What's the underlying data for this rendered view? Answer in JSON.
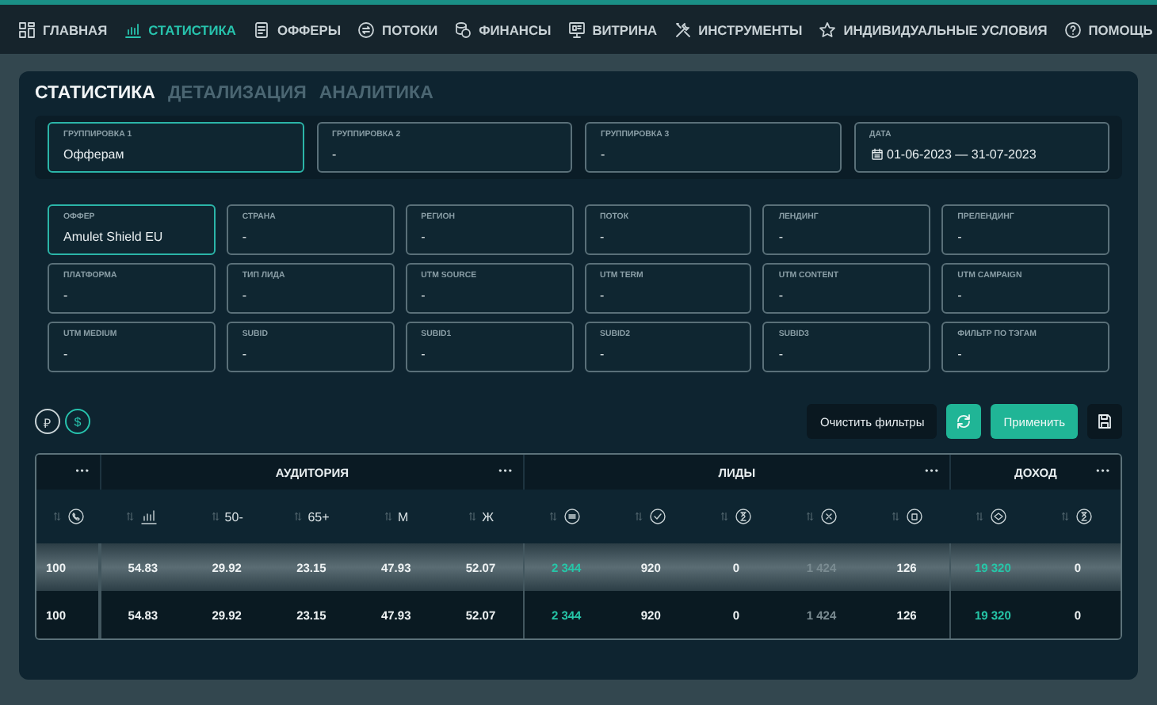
{
  "nav": [
    {
      "label": "ГЛАВНАЯ",
      "selected": false
    },
    {
      "label": "СТАТИСТИКА",
      "selected": true
    },
    {
      "label": "ОФФЕРЫ",
      "selected": false
    },
    {
      "label": "ПОТОКИ",
      "selected": false
    },
    {
      "label": "ФИНАНСЫ",
      "selected": false
    },
    {
      "label": "ВИТРИНА",
      "selected": false
    },
    {
      "label": "ИНСТРУМЕНТЫ",
      "selected": false
    },
    {
      "label": "ИНДИВИДУАЛЬНЫЕ УСЛОВИЯ",
      "selected": false
    },
    {
      "label": "ПОМОЩЬ",
      "selected": false
    }
  ],
  "tabs": [
    {
      "label": "СТАТИСТИКА",
      "selected": true
    },
    {
      "label": "ДЕТАЛИЗАЦИЯ",
      "selected": false
    },
    {
      "label": "АНАЛИТИКА",
      "selected": false
    }
  ],
  "grouping": [
    {
      "kind": "select",
      "label": "ГРУППИРОВКА 1",
      "value": "Офферам",
      "focused": true
    },
    {
      "kind": "select",
      "label": "ГРУППИРОВКА 2",
      "value": "-",
      "focused": false
    },
    {
      "kind": "select",
      "label": "ГРУППИРОВКА 3",
      "value": "-",
      "focused": false
    },
    {
      "kind": "date",
      "label": "ДАТА",
      "value": "01-06-2023 — 31-07-2023",
      "focused": false
    }
  ],
  "filters": [
    {
      "label": "ОФФЕР",
      "value": "Amulet Shield EU",
      "focused": true
    },
    {
      "label": "СТРАНА",
      "value": "-",
      "focused": false
    },
    {
      "label": "РЕГИОН",
      "value": "-",
      "focused": false
    },
    {
      "label": "ПОТОК",
      "value": "-",
      "focused": false
    },
    {
      "label": "ЛЕНДИНГ",
      "value": "-",
      "focused": false
    },
    {
      "label": "ПРЕЛЕНДИНГ",
      "value": "-",
      "focused": false
    },
    {
      "label": "ПЛАТФОРМА",
      "value": "-",
      "focused": false
    },
    {
      "label": "ТИП ЛИДА",
      "value": "-",
      "focused": false
    },
    {
      "label": "UTM SOURCE",
      "value": "-",
      "focused": false
    },
    {
      "label": "UTM TERM",
      "value": "-",
      "focused": false
    },
    {
      "label": "UTM CONTENT",
      "value": "-",
      "focused": false
    },
    {
      "label": "UTM CAMPAIGN",
      "value": "-",
      "focused": false
    },
    {
      "label": "UTM MEDIUM",
      "value": "-",
      "focused": false
    },
    {
      "label": "SUBID",
      "value": "-",
      "focused": false
    },
    {
      "label": "SUBID1",
      "value": "-",
      "focused": false
    },
    {
      "label": "SUBID2",
      "value": "-",
      "focused": false
    },
    {
      "label": "SUBID3",
      "value": "-",
      "focused": false
    },
    {
      "label": "ФИЛЬТР ПО ТЭГАМ",
      "value": "-",
      "focused": false
    }
  ],
  "currencies": [
    {
      "symbol": "₽",
      "selected": false
    },
    {
      "symbol": "$",
      "selected": true
    }
  ],
  "actions": {
    "clear": "Очистить фильтры",
    "apply": "Применить"
  },
  "table": {
    "groups": [
      {
        "menu": "•••"
      },
      {
        "label": "АУДИТОРИЯ",
        "menu": "•••"
      },
      {
        "label": "ЛИДЫ",
        "menu": "•••"
      },
      {
        "label": "ДОХОД",
        "menu": "•••"
      }
    ],
    "columns": [
      {
        "kind": "icon",
        "accent": false,
        "dimmed": false
      },
      {
        "kind": "icon",
        "accent": false,
        "dimmed": false
      },
      {
        "kind": "text",
        "label": "50-",
        "accent": false,
        "dimmed": false
      },
      {
        "kind": "text",
        "label": "65+",
        "accent": false,
        "dimmed": false
      },
      {
        "kind": "text",
        "label": "М",
        "accent": false,
        "dimmed": false
      },
      {
        "kind": "text",
        "label": "Ж",
        "accent": false,
        "dimmed": false
      },
      {
        "kind": "icon",
        "accent": true,
        "dimmed": false
      },
      {
        "kind": "icon",
        "accent": false,
        "dimmed": false
      },
      {
        "kind": "icon",
        "accent": false,
        "dimmed": false
      },
      {
        "kind": "icon",
        "accent": false,
        "dimmed": true
      },
      {
        "kind": "icon",
        "accent": false,
        "dimmed": false
      },
      {
        "kind": "icon",
        "accent": true,
        "dimmed": false
      },
      {
        "kind": "icon",
        "accent": false,
        "dimmed": false
      }
    ],
    "rows": [
      {
        "highlighted": true,
        "cells": [
          "100",
          "54.83",
          "29.92",
          "23.15",
          "47.93",
          "52.07",
          "2 344",
          "920",
          "0",
          "1 424",
          "126",
          "19 320",
          "0"
        ]
      },
      {
        "highlighted": false,
        "cells": [
          "100",
          "54.83",
          "29.92",
          "23.15",
          "47.93",
          "52.07",
          "2 344",
          "920",
          "0",
          "1 424",
          "126",
          "19 320",
          "0"
        ]
      }
    ]
  }
}
